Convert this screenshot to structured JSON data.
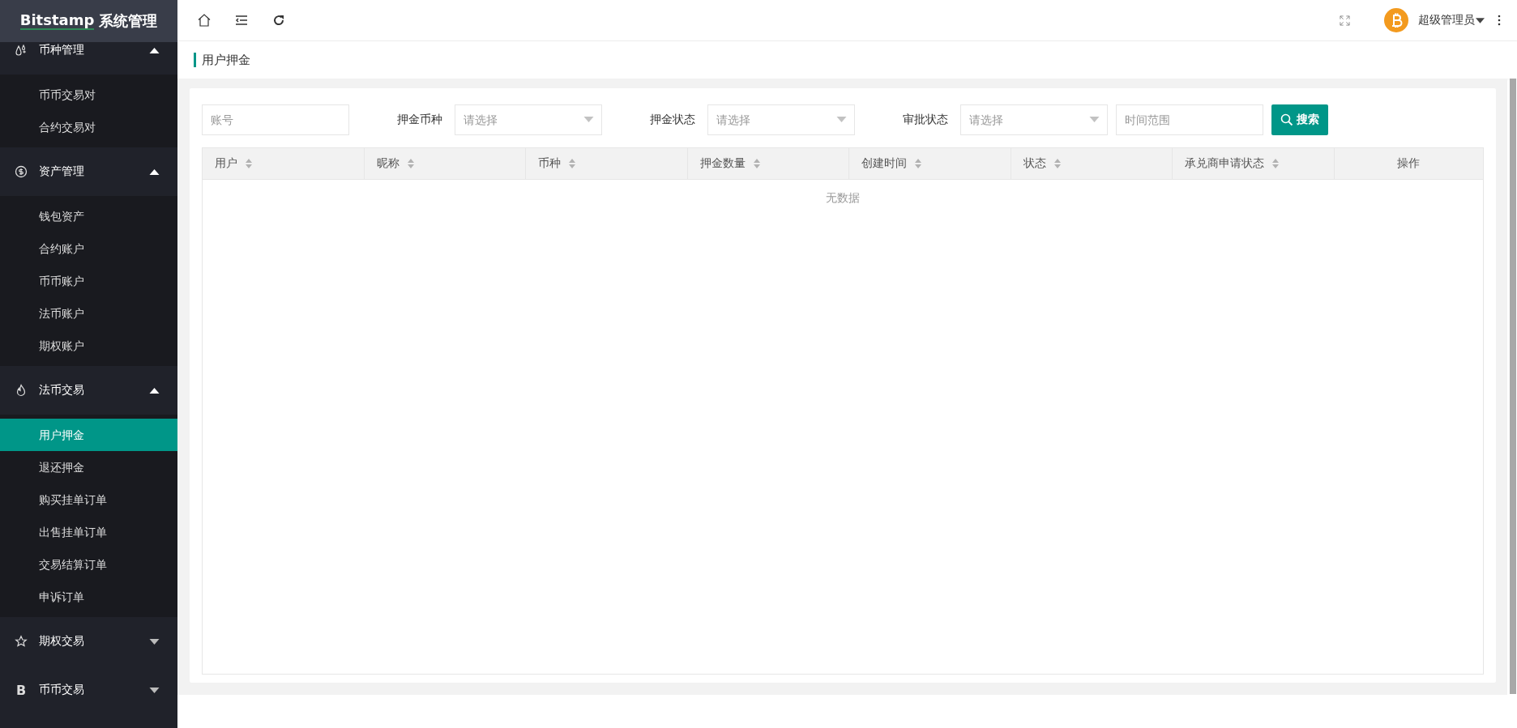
{
  "logo": {
    "brand": "Bitstamp",
    "title": "系统管理"
  },
  "sidebar": {
    "groups": [
      {
        "label": "币种管理",
        "expanded": true,
        "children": [
          {
            "label": "币币交易对",
            "selected": false
          },
          {
            "label": "合约交易对",
            "selected": false
          }
        ]
      },
      {
        "label": "资产管理",
        "expanded": true,
        "children": [
          {
            "label": "钱包资产",
            "selected": false
          },
          {
            "label": "合约账户",
            "selected": false
          },
          {
            "label": "币币账户",
            "selected": false
          },
          {
            "label": "法币账户",
            "selected": false
          },
          {
            "label": "期权账户",
            "selected": false
          }
        ]
      },
      {
        "label": "法币交易",
        "expanded": true,
        "children": [
          {
            "label": "用户押金",
            "selected": true
          },
          {
            "label": "退还押金",
            "selected": false
          },
          {
            "label": "购买挂单订单",
            "selected": false
          },
          {
            "label": "出售挂单订单",
            "selected": false
          },
          {
            "label": "交易结算订单",
            "selected": false
          },
          {
            "label": "申诉订单",
            "selected": false
          }
        ]
      },
      {
        "label": "期权交易",
        "expanded": false
      },
      {
        "label": "币币交易",
        "expanded": false,
        "icon_text": "B"
      }
    ]
  },
  "header": {
    "user": "超级管理员"
  },
  "breadcrumb": "用户押金",
  "filters": [
    {
      "kind": "input",
      "placeholder": "账号"
    },
    {
      "kind": "select",
      "label": "押金币种",
      "placeholder": "请选择"
    },
    {
      "kind": "select",
      "label": "押金状态",
      "placeholder": "请选择"
    },
    {
      "kind": "select",
      "label": "审批状态",
      "placeholder": "请选择"
    },
    {
      "kind": "input",
      "placeholder": "时间范围"
    }
  ],
  "search_button": "搜索",
  "table": {
    "columns": [
      {
        "label": "用户",
        "sortable": true
      },
      {
        "label": "昵称",
        "sortable": true
      },
      {
        "label": "币种",
        "sortable": true
      },
      {
        "label": "押金数量",
        "sortable": true
      },
      {
        "label": "创建时间",
        "sortable": true
      },
      {
        "label": "状态",
        "sortable": true
      },
      {
        "label": "承兑商申请状态",
        "sortable": true
      },
      {
        "label": "操作",
        "sortable": false
      }
    ],
    "empty_text": "无数据"
  }
}
